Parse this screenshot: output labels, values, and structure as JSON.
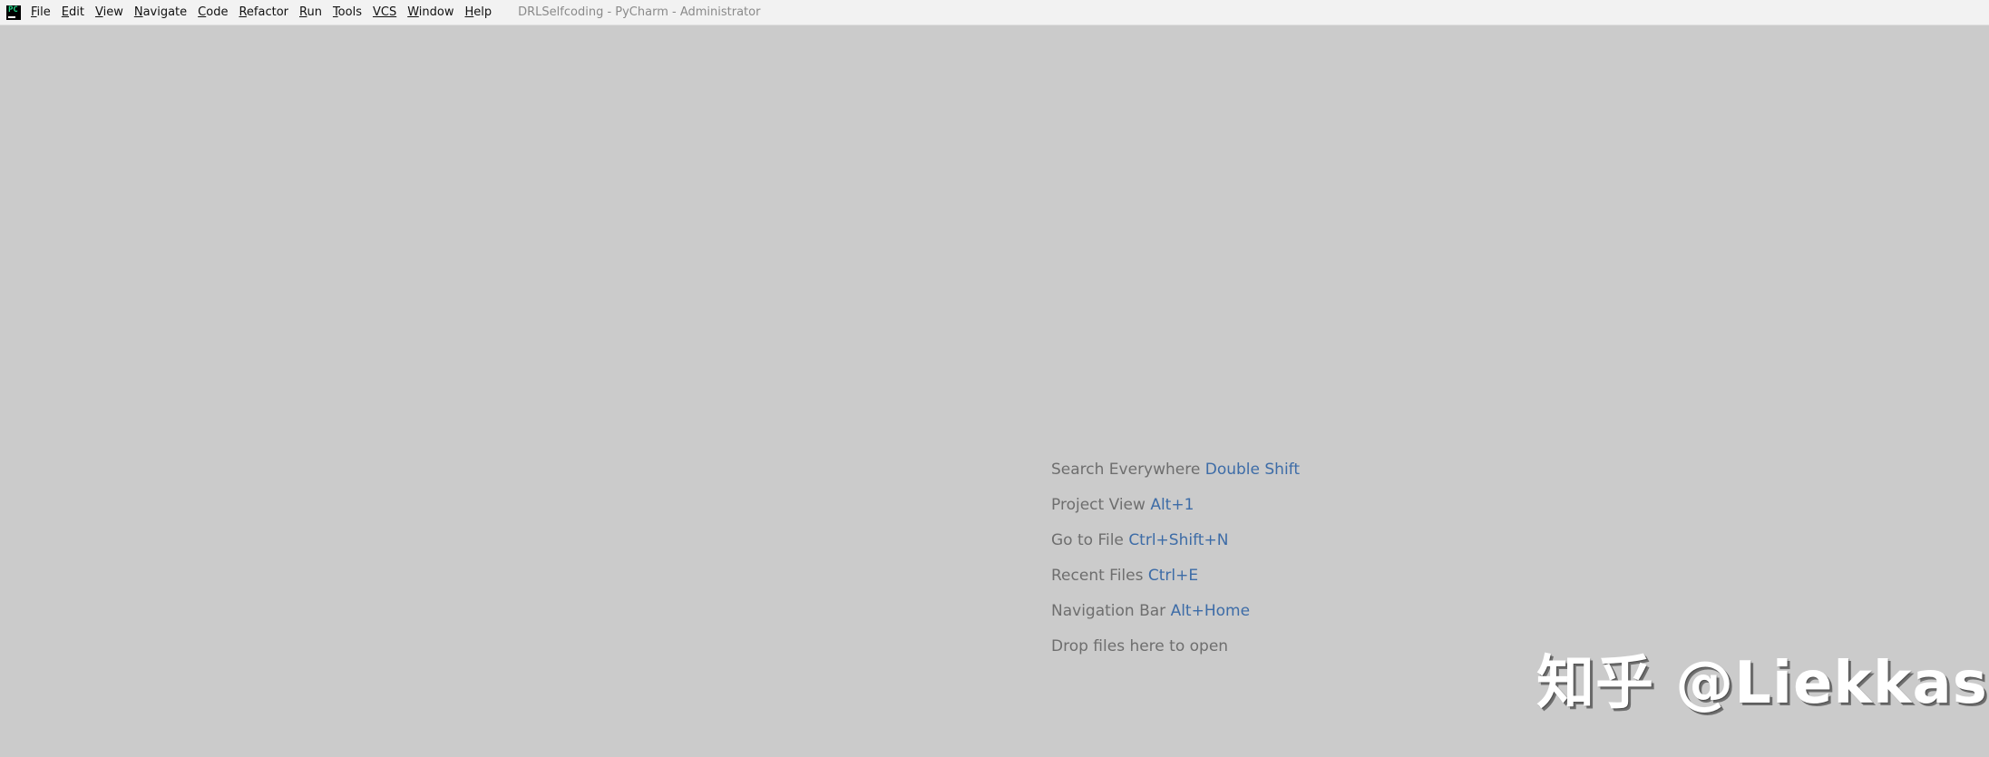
{
  "menubar": {
    "items": [
      {
        "mnemonic": "F",
        "rest": "ile"
      },
      {
        "mnemonic": "E",
        "rest": "dit"
      },
      {
        "mnemonic": "V",
        "rest": "iew"
      },
      {
        "mnemonic": "N",
        "rest": "avigate"
      },
      {
        "mnemonic": "C",
        "rest": "ode"
      },
      {
        "mnemonic": "R",
        "rest": "efactor"
      },
      {
        "mnemonic": "R",
        "rest": "un"
      },
      {
        "mnemonic": "T",
        "rest": "ools"
      },
      {
        "mnemonic": "",
        "rest": "VCS"
      },
      {
        "mnemonic": "W",
        "rest": "indow"
      },
      {
        "mnemonic": "H",
        "rest": "elp"
      }
    ]
  },
  "window": {
    "title": "DRLSelfcoding - PyCharm - Administrator",
    "app_icon": "pycharm-icon"
  },
  "welcome": {
    "hints": [
      {
        "label": "Search Everywhere",
        "shortcut": "Double Shift"
      },
      {
        "label": "Project View",
        "shortcut": "Alt+1"
      },
      {
        "label": "Go to File",
        "shortcut": "Ctrl+Shift+N"
      },
      {
        "label": "Recent Files",
        "shortcut": "Ctrl+E"
      },
      {
        "label": "Navigation Bar",
        "shortcut": "Alt+Home"
      },
      {
        "label": "Drop files here to open",
        "shortcut": ""
      }
    ]
  },
  "watermark": {
    "text": "知乎 @Liekkas"
  },
  "colors": {
    "background": "#cbcbcb",
    "titlebar": "#f2f2f2",
    "hint_text": "#6e6e6e",
    "shortcut_text": "#3d6ca7"
  }
}
